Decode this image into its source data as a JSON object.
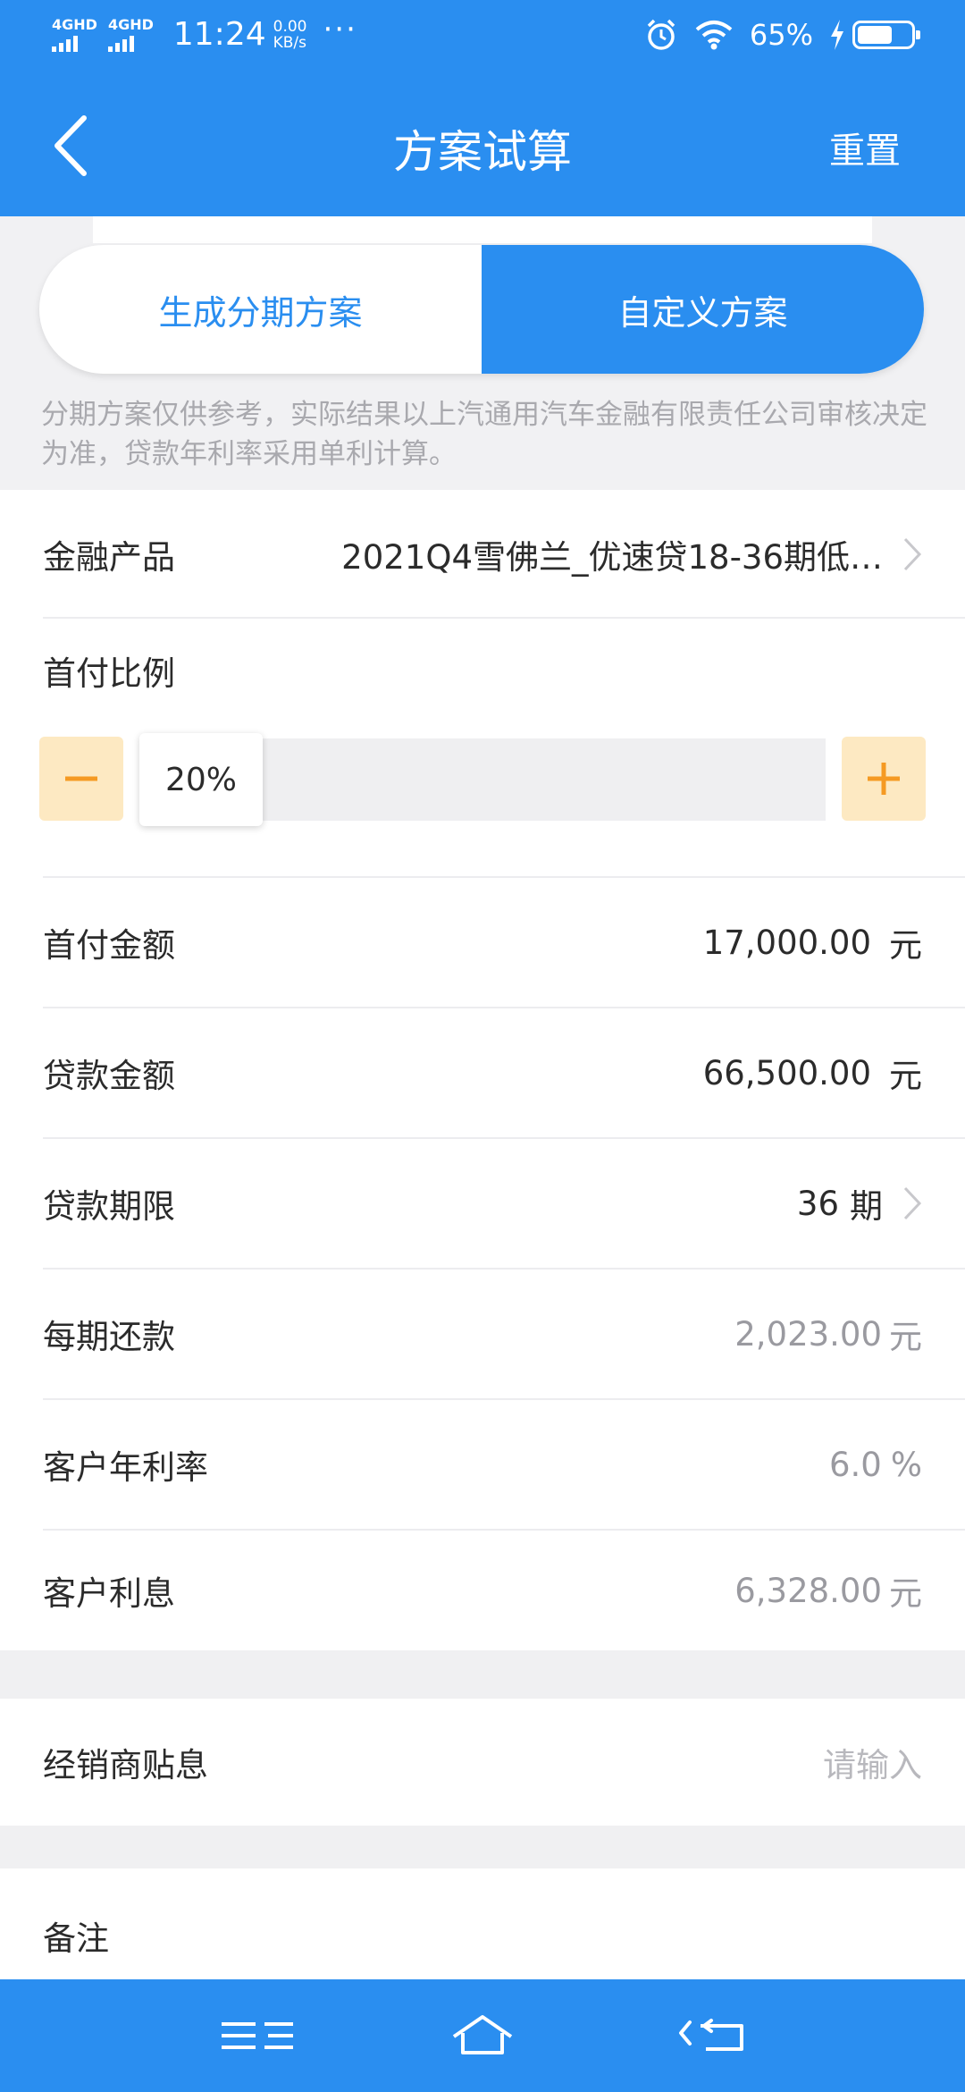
{
  "status_bar": {
    "network_1": "4GHD",
    "network_2": "4GHD",
    "time": "11:24",
    "speed_value": "0.00",
    "speed_unit": "KB/s",
    "more": "···",
    "battery_percent": "65%",
    "battery_level": 0.65,
    "icons": [
      "alarm-icon",
      "wifi-icon",
      "charging-icon",
      "battery-icon"
    ]
  },
  "header": {
    "title": "方案试算",
    "reset_label": "重置",
    "back_icon": "chevron-left-icon"
  },
  "tabs": [
    {
      "label": "生成分期方案",
      "active": false
    },
    {
      "label": "自定义方案",
      "active": true
    }
  ],
  "disclaimer": "分期方案仅供参考，实际结果以上汽通用汽车金融有限责任公司审核决定为准，贷款年利率采用单利计算。",
  "form": {
    "product": {
      "label": "金融产品",
      "value": "2021Q4雪佛兰_优速贷18-36期低…"
    },
    "down_payment_ratio": {
      "label": "首付比例",
      "value": "20%",
      "minus": "−",
      "plus": "+"
    },
    "down_payment_amount": {
      "label": "首付金额",
      "value": "17,000.00",
      "unit": "元"
    },
    "loan_amount": {
      "label": "贷款金额",
      "value": "66,500.00",
      "unit": "元"
    },
    "loan_term": {
      "label": "贷款期限",
      "value": "36",
      "unit": "期"
    },
    "monthly_payment": {
      "label": "每期还款",
      "value": "2,023.00",
      "unit": "元"
    },
    "annual_rate": {
      "label": "客户年利率",
      "value": "6.0",
      "unit": "%"
    },
    "interest": {
      "label": "客户利息",
      "value": "6,328.00",
      "unit": "元"
    }
  },
  "dealer_subsidy": {
    "label": "经销商贴息",
    "placeholder": "请输入"
  },
  "note": {
    "label": "备注"
  },
  "colors": {
    "primary": "#2a8ef0",
    "stepper_bg": "#fde9c2",
    "stepper_icon": "#f59a23"
  },
  "system_nav": [
    "menu-icon",
    "home-icon",
    "back-icon"
  ]
}
